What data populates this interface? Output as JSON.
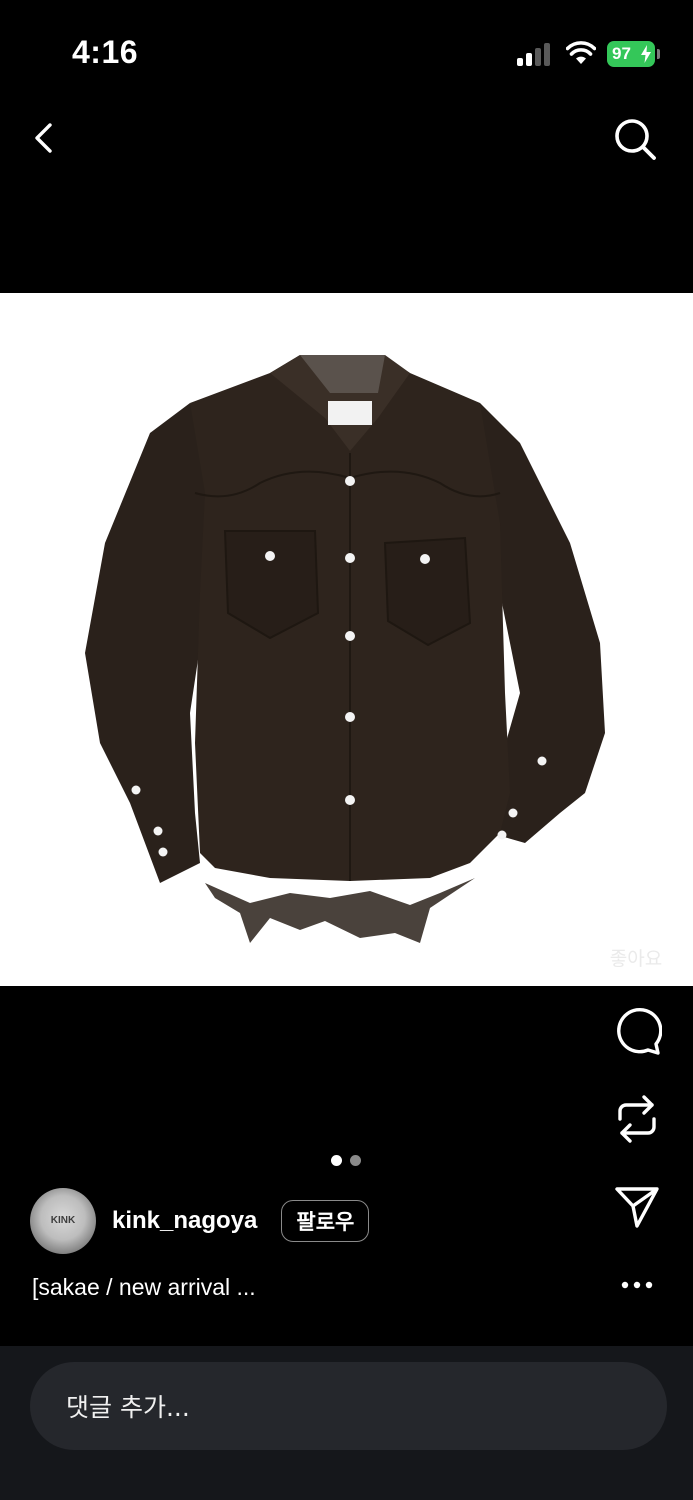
{
  "status_bar": {
    "time": "4:16",
    "battery": "97"
  },
  "colors": {
    "battery": "#34c759",
    "background": "#000000",
    "comment_bar": "#15171b",
    "comment_field": "#25272c"
  },
  "icons": {
    "back": "chevron-left-icon",
    "search": "search-icon",
    "like": "heart-icon",
    "comment": "comment-bubble-icon",
    "repost": "repost-icon",
    "share": "send-icon",
    "more": "more-icon"
  },
  "post": {
    "image_description": "dark brown western suede shirt with pearl snap buttons",
    "carousel": {
      "count": 2,
      "active": 1
    },
    "like_label": "좋아요",
    "author": {
      "username": "kink_nagoya",
      "avatar_text": "KINK"
    },
    "follow_label": "팔로우",
    "caption": "[sakae / new arrival ..."
  },
  "comment_box": {
    "placeholder": "댓글 추가..."
  }
}
